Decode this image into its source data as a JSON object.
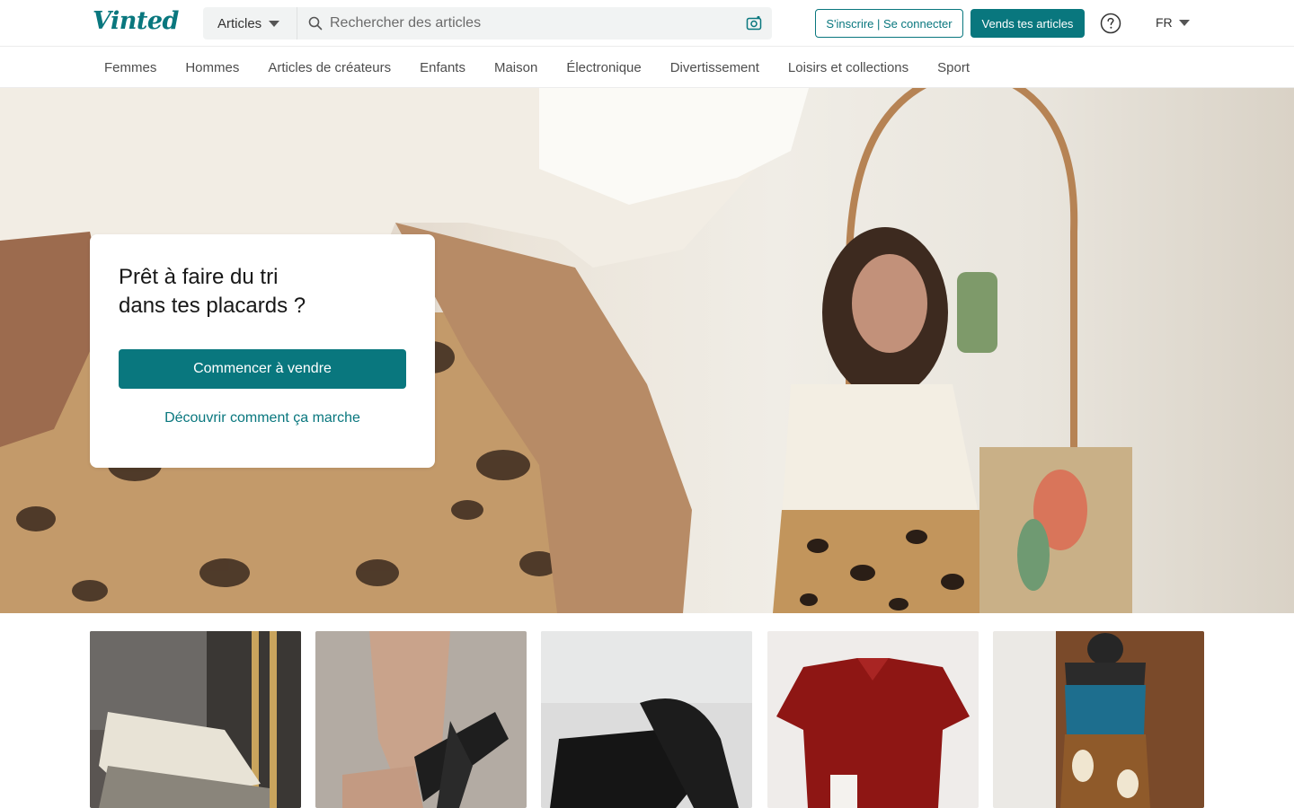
{
  "header": {
    "logo": "Vinted",
    "search": {
      "category_label": "Articles",
      "placeholder": "Rechercher des articles"
    },
    "signup_label": "S'inscrire | Se connecter",
    "sell_label": "Vends tes articles",
    "language": "FR",
    "icons": [
      "search-icon",
      "camera-icon",
      "help-icon",
      "chevron-down-icon"
    ]
  },
  "categories": [
    "Femmes",
    "Hommes",
    "Articles de créateurs",
    "Enfants",
    "Maison",
    "Électronique",
    "Divertissement",
    "Loisirs et collections",
    "Sport"
  ],
  "hero": {
    "title_line1": "Prêt à faire du tri",
    "title_line2": "dans tes placards ?",
    "cta_label": "Commencer à vendre",
    "link_label": "Découvrir comment ça marche"
  },
  "items": [
    {
      "name": "sneakers"
    },
    {
      "name": "sandals"
    },
    {
      "name": "slingback-shoes"
    },
    {
      "name": "red-shirt"
    },
    {
      "name": "blue-bustier-top"
    }
  ],
  "colors": {
    "brand": "#09777e",
    "text": "#171717",
    "muted": "#4d4d4d",
    "search_bg": "#f1f3f3"
  }
}
